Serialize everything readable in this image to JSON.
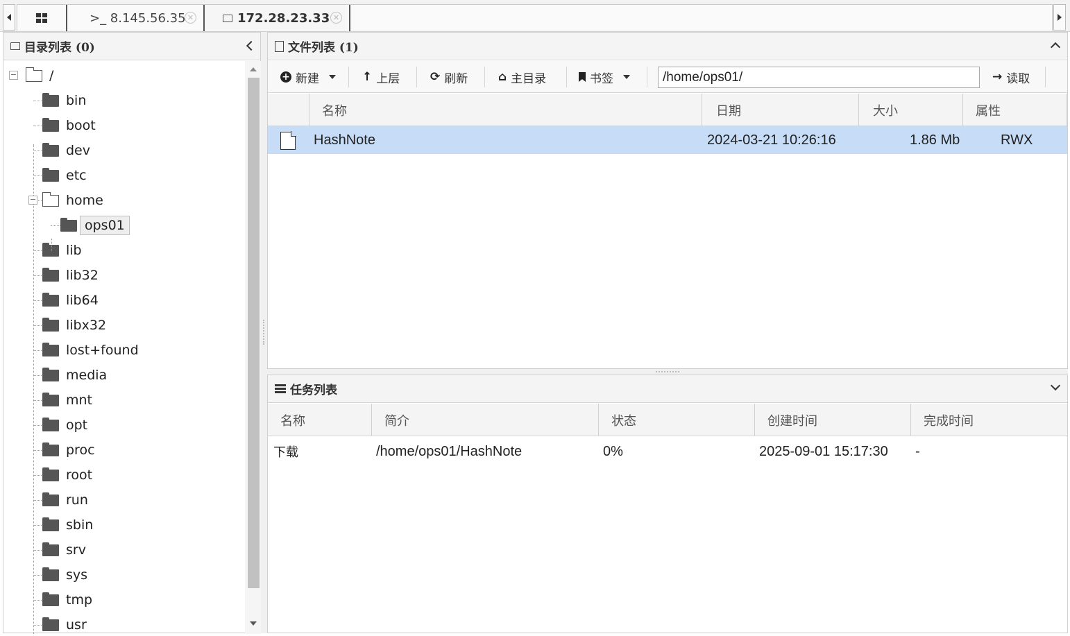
{
  "tabs": [
    {
      "label": ">_ 8.145.56.35",
      "icon": "terminal-icon"
    },
    {
      "label": "172.28.23.33",
      "icon": "folder-icon",
      "active": true
    }
  ],
  "dir_panel": {
    "title": "目录列表 (0)",
    "root": "/",
    "folders": [
      "bin",
      "boot",
      "dev",
      "etc",
      "home",
      "ops01",
      "lib",
      "lib32",
      "lib64",
      "libx32",
      "lost+found",
      "media",
      "mnt",
      "opt",
      "proc",
      "root",
      "run",
      "sbin",
      "srv",
      "sys",
      "tmp",
      "usr"
    ],
    "selected": "ops01"
  },
  "file_panel": {
    "title": "文件列表 (1)",
    "toolbar": {
      "new": "新建",
      "up": "上层",
      "refresh": "刷新",
      "home": "主目录",
      "bookmark": "书签",
      "read": "读取"
    },
    "path": "/home/ops01/",
    "columns": [
      "名称",
      "日期",
      "大小",
      "属性"
    ],
    "rows": [
      {
        "name": "HashNote",
        "date": "2024-03-21 10:26:16",
        "size": "1.86 Mb",
        "attr": "RWX"
      }
    ]
  },
  "task_panel": {
    "title": "任务列表",
    "columns": [
      "名称",
      "简介",
      "状态",
      "创建时间",
      "完成时间"
    ],
    "rows": [
      {
        "name": "下载",
        "desc": "/home/ops01/HashNote",
        "status": "0%",
        "created": "2025-09-01 15:17:30",
        "finished": "-"
      }
    ]
  },
  "colors": {
    "selected_row": "#c6dcf7",
    "header_bg": "#f4f4f4"
  }
}
